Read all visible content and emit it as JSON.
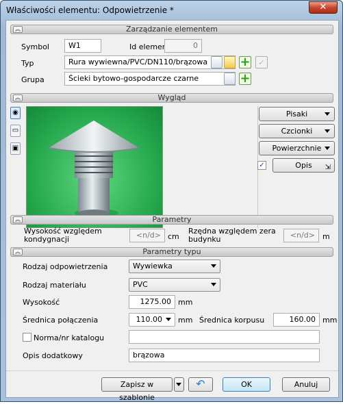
{
  "window": {
    "title": "Właściwości elementu: Odpowietrzenie *",
    "close": "✕"
  },
  "sections": {
    "management": "Zarządzanie elementem",
    "view": "Wygląd",
    "parameters": "Parametry",
    "type_parameters": "Parametry typu"
  },
  "management": {
    "symbol_label": "Symbol",
    "symbol_value": "W1",
    "id_label": "Id elementu",
    "id_value": "0",
    "type_label": "Typ",
    "type_value": "Rura wywiewna/PVC/DN110/brązowa",
    "group_label": "Grupa",
    "group_value": "Ścieki bytowo-gospodarcze czarne"
  },
  "view": {
    "pens": "Pisaki",
    "fonts": "Czcionki",
    "surfaces": "Powierzchnie",
    "description": "Opis",
    "description_checked": true
  },
  "parameters": {
    "height_label": "Wysokość względem kondygnacji",
    "height_value": "<n/d>",
    "height_unit": "cm",
    "ordinate_label": "Rzędna względem zera budynku",
    "ordinate_value": "<n/d>",
    "ordinate_unit": "m"
  },
  "type_parameters": {
    "vent_type_label": "Rodzaj odpowietrzenia",
    "vent_type_value": "Wywiewka",
    "material_label": "Rodzaj materiału",
    "material_value": "PVC",
    "height_label": "Wysokość",
    "height_value": "1275.00",
    "height_unit": "mm",
    "conn_diam_label": "Średnica połączenia",
    "conn_diam_value": "110.00",
    "conn_diam_unit": "mm",
    "body_diam_label": "Średnica korpusu",
    "body_diam_value": "160.00",
    "body_diam_unit": "mm",
    "catalog_label": "Norma/nr katalogu",
    "catalog_value": "",
    "notes_label": "Opis dodatkowy",
    "notes_value": "brązowa"
  },
  "footer": {
    "save_template": "Zapisz w szablonie",
    "ok": "OK",
    "cancel": "Anuluj"
  }
}
